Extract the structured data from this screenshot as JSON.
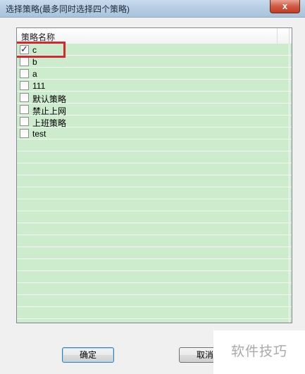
{
  "window": {
    "title": "选择策略(最多同时选择四个策略)",
    "close_glyph": "x"
  },
  "list": {
    "column_header": "策略名称",
    "items": [
      {
        "label": "c",
        "checked": true
      },
      {
        "label": "b",
        "checked": false
      },
      {
        "label": "a",
        "checked": false
      },
      {
        "label": "111",
        "checked": false
      },
      {
        "label": "默认策略",
        "checked": false
      },
      {
        "label": "禁止上网",
        "checked": false
      },
      {
        "label": "上班策略",
        "checked": false
      },
      {
        "label": "test",
        "checked": false
      }
    ]
  },
  "buttons": {
    "ok_label": "确定",
    "cancel_label": "取消"
  },
  "watermark": {
    "corner_text": "软件技巧"
  },
  "colors": {
    "list_background": "#cdeccd",
    "highlight_border": "#d9262b"
  }
}
